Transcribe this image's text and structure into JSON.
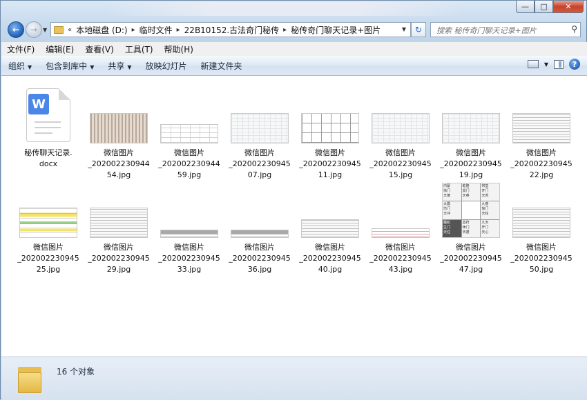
{
  "window": {
    "caption_buttons": {
      "minimize": "—",
      "maximize": "□",
      "close": "✕"
    }
  },
  "address": {
    "prefix": "«",
    "breadcrumbs": [
      "本地磁盘 (D:)",
      "临时文件",
      "22B10152.古法奇门秘传",
      "秘传奇门聊天记录+图片"
    ],
    "search_placeholder": "搜索 秘传奇门聊天记录+图片"
  },
  "menu": [
    "文件(F)",
    "编辑(E)",
    "查看(V)",
    "工具(T)",
    "帮助(H)"
  ],
  "commands": [
    {
      "label": "组织",
      "dropdown": true
    },
    {
      "label": "包含到库中",
      "dropdown": true
    },
    {
      "label": "共享",
      "dropdown": true
    },
    {
      "label": "放映幻灯片",
      "dropdown": false
    },
    {
      "label": "新建文件夹",
      "dropdown": false
    }
  ],
  "icons": {
    "back": "arrow-left-icon",
    "forward": "arrow-right-icon",
    "refresh": "refresh-icon",
    "search": "search-icon",
    "help": "help-icon"
  },
  "files": [
    {
      "line1": "秘传聊天记录.",
      "line2": "docx",
      "kind": "docx",
      "badge": "W"
    },
    {
      "line1": "微信图片",
      "line2": "_202002230944",
      "line3": "54.jpg",
      "kind": "photo"
    },
    {
      "line1": "微信图片",
      "line2": "_202002230944",
      "line3": "59.jpg",
      "kind": "table"
    },
    {
      "line1": "微信图片",
      "line2": "_202002230945",
      "line3": "07.jpg",
      "kind": "sheet"
    },
    {
      "line1": "微信图片",
      "line2": "_202002230945",
      "line3": "11.jpg",
      "kind": "grid"
    },
    {
      "line1": "微信图片",
      "line2": "_202002230945",
      "line3": "15.jpg",
      "kind": "sheet"
    },
    {
      "line1": "微信图片",
      "line2": "_202002230945",
      "line3": "19.jpg",
      "kind": "sheet"
    },
    {
      "line1": "微信图片",
      "line2": "_202002230945",
      "line3": "22.jpg",
      "kind": "text"
    },
    {
      "line1": "微信图片",
      "line2": "_202002230945",
      "line3": "25.jpg",
      "kind": "yellow"
    },
    {
      "line1": "微信图片",
      "line2": "_202002230945",
      "line3": "29.jpg",
      "kind": "text"
    },
    {
      "line1": "微信图片",
      "line2": "_202002230945",
      "line3": "33.jpg",
      "kind": "strip"
    },
    {
      "line1": "微信图片",
      "line2": "_202002230945",
      "line3": "36.jpg",
      "kind": "strip"
    },
    {
      "line1": "微信图片",
      "line2": "_202002230945",
      "line3": "40.jpg",
      "kind": "lines"
    },
    {
      "line1": "微信图片",
      "line2": "_202002230945",
      "line3": "43.jpg",
      "kind": "red"
    },
    {
      "line1": "微信图片",
      "line2": "_202002230945",
      "line3": "47.jpg",
      "kind": "qimen"
    },
    {
      "line1": "微信图片",
      "line2": "_202002230945",
      "line3": "50.jpg",
      "kind": "text"
    }
  ],
  "qimen_cells": [
    [
      "内蒙",
      "惊门",
      "天蓬"
    ],
    [
      "乾隆",
      "景门",
      "天英"
    ],
    [
      "常堂",
      "开门",
      "天芮"
    ],
    [
      "大震",
      "伤门",
      "天冲"
    ],
    [
      "",
      "",
      ""
    ],
    [
      "九巷",
      "惊门",
      "天柱"
    ],
    [
      "螣蛇",
      "生门",
      "天任"
    ],
    [
      "直符",
      "休门",
      "天蓬"
    ],
    [
      "九天",
      "开门",
      "天心"
    ]
  ],
  "status": {
    "count_text": "16 个对象"
  }
}
